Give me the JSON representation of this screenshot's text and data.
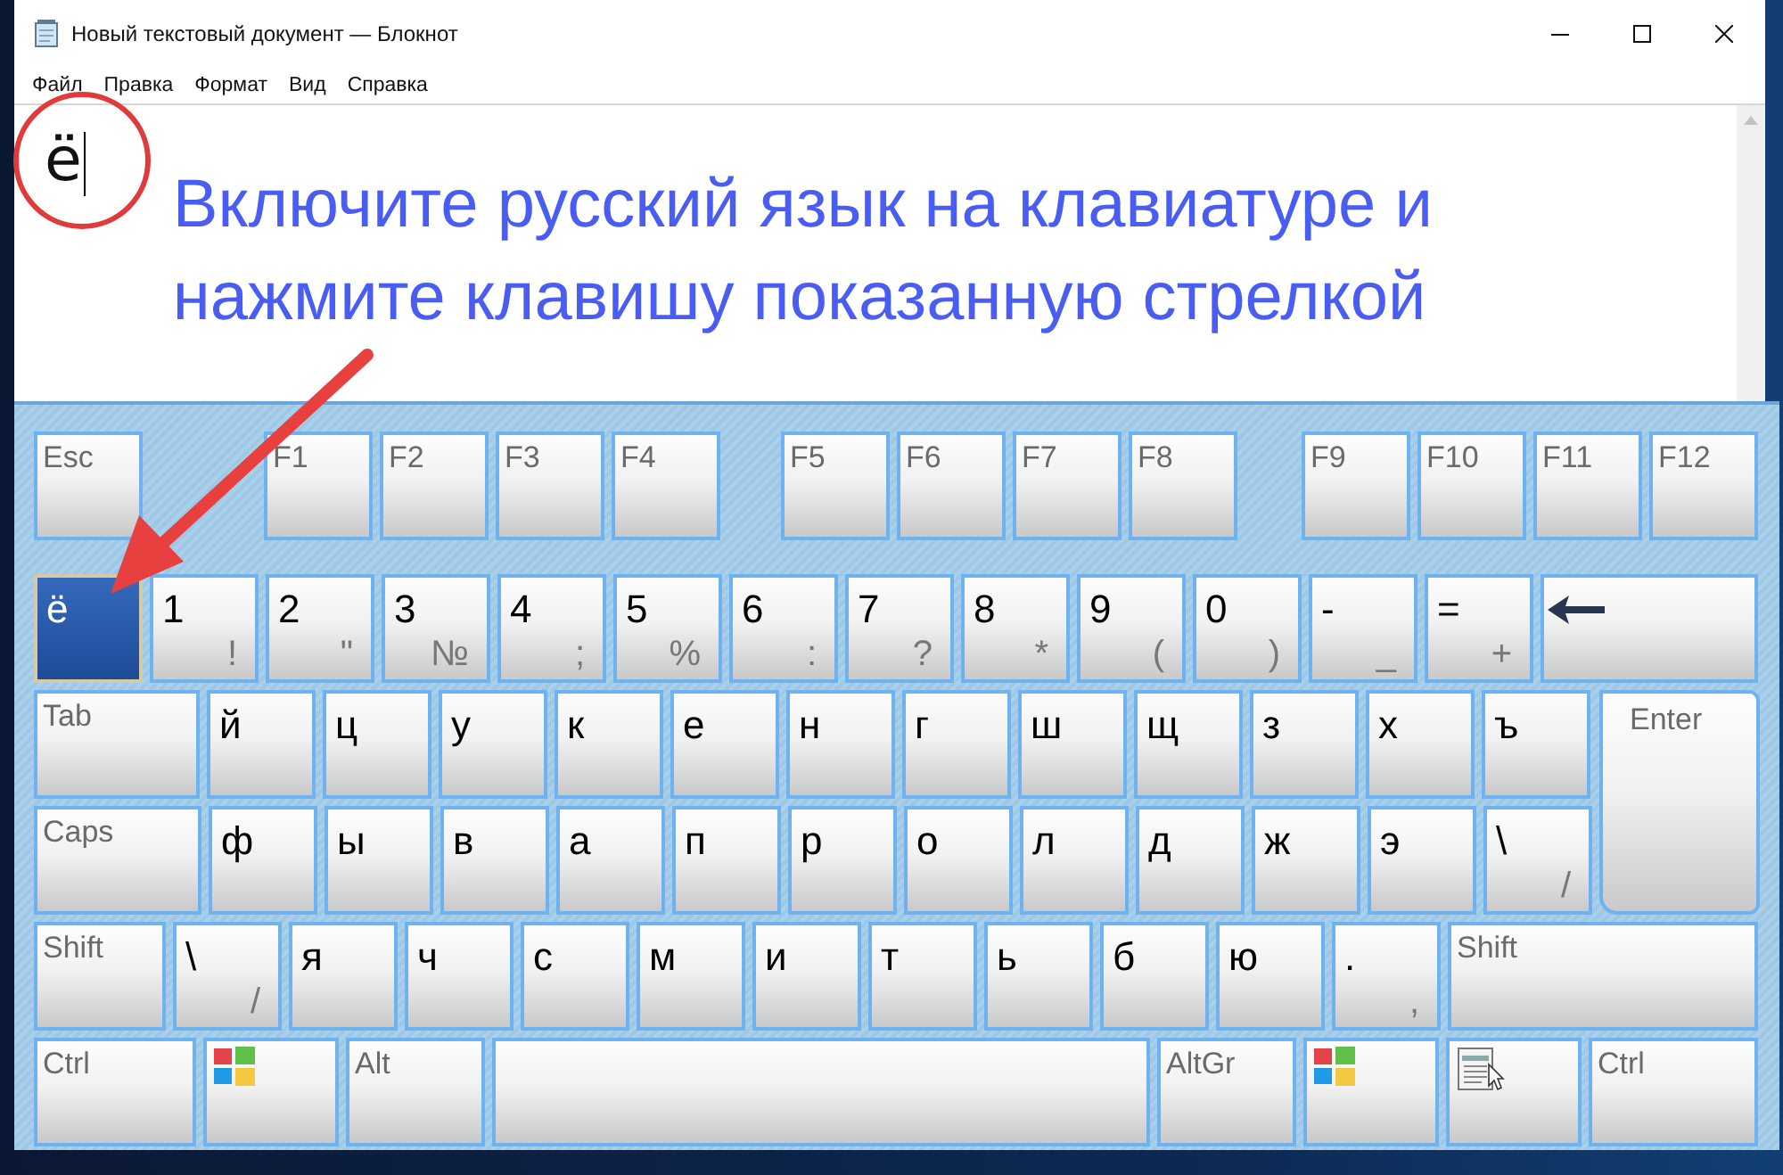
{
  "window": {
    "title": "Новый текстовый документ — Блокнот",
    "menu": [
      "Файл",
      "Правка",
      "Формат",
      "Вид",
      "Справка"
    ]
  },
  "editor": {
    "text": "ё",
    "annotation": [
      "Включите русский язык на клавиатуре и",
      "нажмите клавишу показанную стрелкой"
    ]
  },
  "keyboard": {
    "function_groups": [
      [
        {
          "kind": "name",
          "label": "Esc",
          "pressed": false
        }
      ],
      [
        {
          "kind": "name",
          "label": "F1",
          "pressed": false
        },
        {
          "kind": "name",
          "label": "F2",
          "pressed": false
        },
        {
          "kind": "name",
          "label": "F3",
          "pressed": false
        },
        {
          "kind": "name",
          "label": "F4",
          "pressed": false
        }
      ],
      [
        {
          "kind": "name",
          "label": "F5",
          "pressed": false
        },
        {
          "kind": "name",
          "label": "F6",
          "pressed": false
        },
        {
          "kind": "name",
          "label": "F7",
          "pressed": false
        },
        {
          "kind": "name",
          "label": "F8",
          "pressed": false
        }
      ],
      [
        {
          "kind": "name",
          "label": "F9",
          "pressed": false
        },
        {
          "kind": "name",
          "label": "F10",
          "pressed": false
        },
        {
          "kind": "name",
          "label": "F11",
          "pressed": false
        },
        {
          "kind": "name",
          "label": "F12",
          "pressed": false
        }
      ]
    ],
    "rows": [
      [
        {
          "kind": "char",
          "label": "ё",
          "pressed": true
        },
        {
          "kind": "char",
          "label": "1",
          "shift": "!",
          "pressed": false
        },
        {
          "kind": "char",
          "label": "2",
          "shift": "\"",
          "pressed": false
        },
        {
          "kind": "char",
          "label": "3",
          "shift": "№",
          "pressed": false
        },
        {
          "kind": "char",
          "label": "4",
          "shift": ";",
          "pressed": false
        },
        {
          "kind": "char",
          "label": "5",
          "shift": "%",
          "pressed": false
        },
        {
          "kind": "char",
          "label": "6",
          "shift": ":",
          "pressed": false
        },
        {
          "kind": "char",
          "label": "7",
          "shift": "?",
          "pressed": false
        },
        {
          "kind": "char",
          "label": "8",
          "shift": "*",
          "pressed": false
        },
        {
          "kind": "char",
          "label": "9",
          "shift": "(",
          "pressed": false
        },
        {
          "kind": "char",
          "label": "0",
          "shift": ")",
          "pressed": false
        },
        {
          "kind": "char",
          "label": "-",
          "shift": "_",
          "pressed": false
        },
        {
          "kind": "char",
          "label": "=",
          "shift": "+",
          "pressed": false
        },
        {
          "kind": "backspace",
          "pressed": false
        }
      ],
      [
        {
          "kind": "name",
          "label": "Tab",
          "pressed": false
        },
        {
          "kind": "char",
          "label": "й",
          "pressed": false
        },
        {
          "kind": "char",
          "label": "ц",
          "pressed": false
        },
        {
          "kind": "char",
          "label": "у",
          "pressed": false
        },
        {
          "kind": "char",
          "label": "к",
          "pressed": false
        },
        {
          "kind": "char",
          "label": "е",
          "pressed": false
        },
        {
          "kind": "char",
          "label": "н",
          "pressed": false
        },
        {
          "kind": "char",
          "label": "г",
          "pressed": false
        },
        {
          "kind": "char",
          "label": "ш",
          "pressed": false
        },
        {
          "kind": "char",
          "label": "щ",
          "pressed": false
        },
        {
          "kind": "char",
          "label": "з",
          "pressed": false
        },
        {
          "kind": "char",
          "label": "х",
          "pressed": false
        },
        {
          "kind": "char",
          "label": "ъ",
          "pressed": false
        },
        {
          "kind": "tall-name",
          "label": "Enter",
          "pressed": false
        }
      ],
      [
        {
          "kind": "name",
          "label": "Caps",
          "pressed": false
        },
        {
          "kind": "char",
          "label": "ф",
          "pressed": false
        },
        {
          "kind": "char",
          "label": "ы",
          "pressed": false
        },
        {
          "kind": "char",
          "label": "в",
          "pressed": false
        },
        {
          "kind": "char",
          "label": "а",
          "pressed": false
        },
        {
          "kind": "char",
          "label": "п",
          "pressed": false
        },
        {
          "kind": "char",
          "label": "р",
          "pressed": false
        },
        {
          "kind": "char",
          "label": "о",
          "pressed": false
        },
        {
          "kind": "char",
          "label": "л",
          "pressed": false
        },
        {
          "kind": "char",
          "label": "д",
          "pressed": false
        },
        {
          "kind": "char",
          "label": "ж",
          "pressed": false
        },
        {
          "kind": "char",
          "label": "э",
          "pressed": false
        },
        {
          "kind": "char",
          "label": "\\",
          "shift": "/",
          "pressed": false
        }
      ],
      [
        {
          "kind": "name",
          "label": "Shift",
          "pressed": false
        },
        {
          "kind": "char",
          "label": "\\",
          "shift": "/",
          "pressed": false
        },
        {
          "kind": "char",
          "label": "я",
          "pressed": false
        },
        {
          "kind": "char",
          "label": "ч",
          "pressed": false
        },
        {
          "kind": "char",
          "label": "с",
          "pressed": false
        },
        {
          "kind": "char",
          "label": "м",
          "pressed": false
        },
        {
          "kind": "char",
          "label": "и",
          "pressed": false
        },
        {
          "kind": "char",
          "label": "т",
          "pressed": false
        },
        {
          "kind": "char",
          "label": "ь",
          "pressed": false
        },
        {
          "kind": "char",
          "label": "б",
          "pressed": false
        },
        {
          "kind": "char",
          "label": "ю",
          "pressed": false
        },
        {
          "kind": "char",
          "label": ".",
          "shift": ",",
          "pressed": false
        },
        {
          "kind": "name",
          "label": "Shift",
          "pressed": false
        }
      ],
      [
        {
          "kind": "name",
          "label": "Ctrl",
          "pressed": false
        },
        {
          "kind": "windows",
          "pressed": false
        },
        {
          "kind": "name",
          "label": "Alt",
          "pressed": false
        },
        {
          "kind": "space",
          "pressed": false
        },
        {
          "kind": "name",
          "label": "AltGr",
          "pressed": false
        },
        {
          "kind": "windows",
          "pressed": false
        },
        {
          "kind": "menu",
          "pressed": false
        },
        {
          "kind": "name",
          "label": "Ctrl",
          "pressed": false
        }
      ]
    ]
  }
}
